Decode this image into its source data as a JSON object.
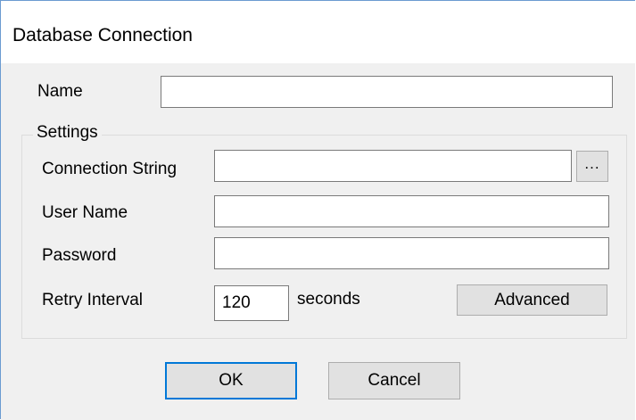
{
  "window": {
    "title": "Database Connection"
  },
  "form": {
    "name_label": "Name",
    "name_value": "",
    "settings_group_label": "Settings",
    "connection_string_label": "Connection String",
    "connection_string_value": "",
    "browse_button_label": "...",
    "user_name_label": "User Name",
    "user_name_value": "",
    "password_label": "Password",
    "password_value": "",
    "retry_interval_label": "Retry Interval",
    "retry_interval_value": "120",
    "retry_interval_unit": "seconds",
    "advanced_button_label": "Advanced"
  },
  "footer": {
    "ok_label": "OK",
    "cancel_label": "Cancel"
  },
  "colors": {
    "dialog_background": "#f0f0f0",
    "title_background": "#ffffff",
    "window_border": "#6b9bd1",
    "default_button_border": "#0078d7",
    "button_face": "#e1e1e1"
  }
}
